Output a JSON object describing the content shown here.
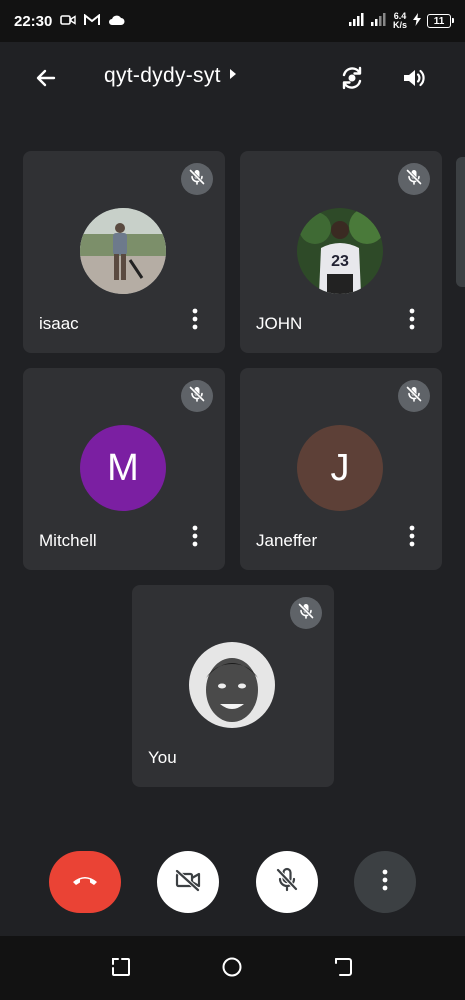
{
  "status_bar": {
    "time": "22:30",
    "net_speed_value": "6.4",
    "net_speed_unit": "K/s",
    "battery_level": "11",
    "icons": [
      "video-camera-icon",
      "gmail-icon",
      "cloud-icon",
      "signal-icon",
      "signal-icon",
      "charging-icon",
      "battery-icon"
    ]
  },
  "header": {
    "meeting_code": "qyt-dydy-syt",
    "icons": [
      "back-arrow-icon",
      "chevron-right-icon",
      "switch-camera-icon",
      "speaker-icon"
    ]
  },
  "participants": [
    {
      "name": "isaac",
      "avatar_type": "photo",
      "muted": true
    },
    {
      "name": "JOHN",
      "avatar_type": "photo",
      "muted": true
    },
    {
      "name": "Mitchell",
      "avatar_type": "letter",
      "avatar_letter": "M",
      "avatar_color": "#7b1fa2",
      "muted": true
    },
    {
      "name": "Janeffer",
      "avatar_type": "letter",
      "avatar_letter": "J",
      "avatar_color": "#5d4037",
      "muted": true
    },
    {
      "name": "You",
      "avatar_type": "photo",
      "muted": true
    }
  ],
  "controls": {
    "icons": [
      "end-call-icon",
      "video-off-icon",
      "mic-off-icon",
      "more-vert-icon"
    ],
    "end_call_color": "#ea4335"
  },
  "nav_bar": {
    "icons": [
      "recent-apps-icon",
      "home-icon",
      "back-icon"
    ]
  }
}
